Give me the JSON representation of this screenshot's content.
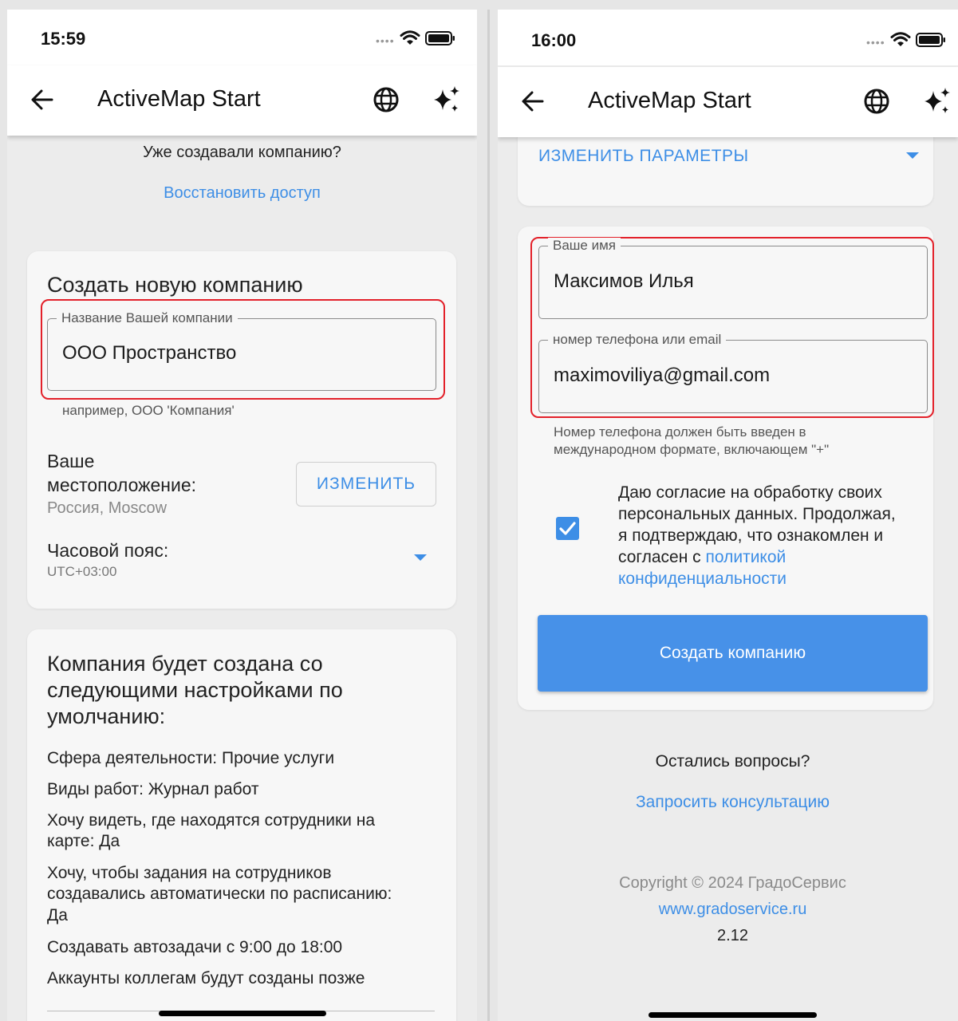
{
  "left": {
    "status_time": "15:59",
    "app_title": "ActiveMap Start",
    "already_created_text": "Уже создавали компанию?",
    "restore_access_link": "Восстановить доступ",
    "create_card": {
      "title": "Создать новую компанию",
      "company_name_label": "Название Вашей компании",
      "company_name_value": "ООО Пространство",
      "company_name_hint": "например, ООО 'Компания'",
      "location_label_line1": "Ваше",
      "location_label_line2": "местоположение:",
      "location_value": "Россия, Moscow",
      "change_button": "ИЗМЕНИТЬ",
      "timezone_label": "Часовой пояс:",
      "timezone_value": "UTC+03:00"
    },
    "defaults_card": {
      "title_line1": "Компания будет создана со",
      "title_line2": "следующими настройками по",
      "title_line3": "умолчанию:",
      "items": [
        [
          "Сфера деятельности: Прочие услуги"
        ],
        [
          "Виды работ: Журнал работ"
        ],
        [
          "Хочу видеть, где находятся сотрудники на",
          "карте: Да"
        ],
        [
          "Хочу, чтобы задания на сотрудников",
          "создавались автоматически по расписанию:",
          "Да"
        ],
        [
          "Создавать автозадачи с 9:00 до 18:00"
        ],
        [
          "Аккаунты коллегам будут созданы позже"
        ]
      ]
    }
  },
  "right": {
    "status_time": "16:00",
    "app_title": "ActiveMap Start",
    "change_params_link": "ИЗМЕНИТЬ ПАРАМЕТРЫ",
    "name_label": "Ваше имя",
    "name_value": "Максимов Илья",
    "contact_label": "номер телефона или email",
    "contact_value": "maximoviliya@gmail.com",
    "phone_hint_line1": "Номер телефона должен быть введен в",
    "phone_hint_line2": "международном формате, включающем \"+\"",
    "consent_checked": true,
    "consent_line1": "Даю согласие на обработку своих",
    "consent_line2": "персональных данных. Продолжая,",
    "consent_line3": "я подтверждаю, что ознакомлен и",
    "consent_line4_prefix": "согласен с ",
    "consent_link_line1": "политикой",
    "consent_link_line2": "конфиденциальности",
    "create_button": "Создать компанию",
    "questions_text": "Остались вопросы?",
    "request_consult_link": "Запросить консультацию",
    "copyright": "Copyright © 2024 ГрадоСервис",
    "website_link": "www.gradoservice.ru",
    "version": "2.12"
  },
  "colors": {
    "accent": "#3d8ee6",
    "highlight": "#e3212a",
    "button": "#4791e8"
  }
}
